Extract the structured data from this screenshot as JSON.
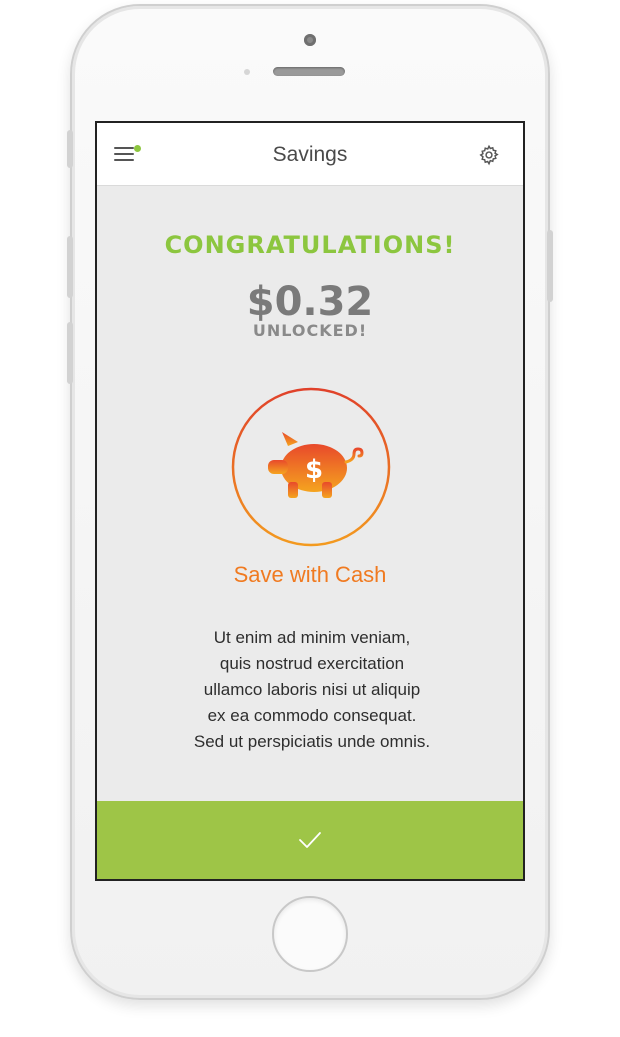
{
  "header": {
    "title": "Savings",
    "menu_icon": "hamburger-menu-icon",
    "notification_dot_color": "#8dc63f",
    "settings_icon": "gear-icon"
  },
  "reward": {
    "headline": "CONGRATULATIONS!",
    "amount": "$0.32",
    "status": "UNLOCKED!",
    "icon": "piggy-bank-dollar-icon",
    "method": "Save with Cash",
    "description_lines": [
      "Ut enim ad minim veniam,",
      "quis nostrud exercitation",
      "ullamco laboris nisi ut aliquip",
      "ex ea commodo consequat.",
      "Sed ut perspiciatis unde omnis."
    ]
  },
  "confirm": {
    "icon": "checkmark-icon"
  },
  "colors": {
    "accent_green": "#8cc63f",
    "confirm_bar": "#9ec547",
    "orange": "#f07a20",
    "background": "#ebebeb"
  }
}
